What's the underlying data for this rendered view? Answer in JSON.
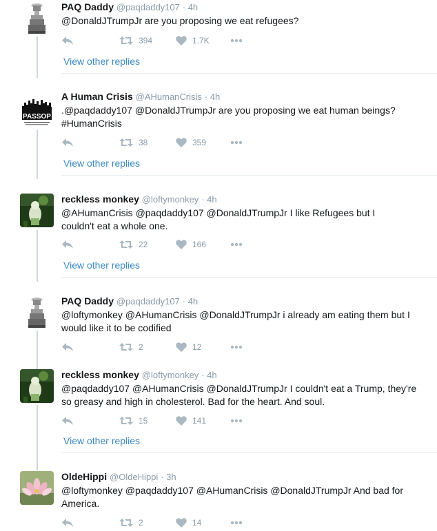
{
  "tweets": [
    {
      "name": "PAQ Daddy",
      "handle": "@paqdaddy107",
      "time": "· 4h",
      "text": "@DonaldJTrumpJr are you proposing we eat refugees?",
      "retweets": "394",
      "likes": "1.7K",
      "view_other": "View other replies",
      "avatar": "stanley-cup"
    },
    {
      "name": "A Human Crisis",
      "handle": "@AHumanCrisis",
      "time": "· 4h",
      "text": ".@paqdaddy107 @DonaldJTrumpJr are you proposing we eat human beings? #HumanCrisis",
      "retweets": "38",
      "likes": "359",
      "view_other": "View other replies",
      "avatar": "passop-logo",
      "logo_text": "PASSOP"
    },
    {
      "name": "reckless monkey",
      "handle": "@loftymonkey",
      "time": "· 4h",
      "text": "@AHumanCrisis @paqdaddy107 @DonaldJTrumpJr I like Refugees but I couldn't eat a whole one.",
      "retweets": "22",
      "likes": "166",
      "view_other": "View other replies",
      "avatar": "monkey-photo"
    },
    {
      "name": "PAQ Daddy",
      "handle": "@paqdaddy107",
      "time": "· 4h",
      "text": "@loftymonkey @AHumanCrisis @DonaldJTrumpJr i already am eating them but I would like it to be codified",
      "retweets": "2",
      "likes": "12",
      "avatar": "stanley-cup"
    },
    {
      "name": "reckless monkey",
      "handle": "@loftymonkey",
      "time": "· 4h",
      "text": "@paqdaddy107 @AHumanCrisis @DonaldJTrumpJr I couldn't eat a Trump, they're so greasy and high in cholesterol. Bad for the heart. And soul.",
      "retweets": "15",
      "likes": "141",
      "view_other": "View other replies",
      "avatar": "monkey-photo"
    },
    {
      "name": "OldeHippi",
      "handle": "@OldeHippi",
      "time": "· 3h",
      "text": "@loftymonkey @paqdaddy107 @AHumanCrisis @DonaldJTrumpJr And bad for America.",
      "retweets": "2",
      "likes": "14",
      "avatar": "lotus-flower"
    }
  ],
  "icons": {
    "reply": "reply-icon",
    "retweet": "retweet-icon",
    "like": "heart-icon",
    "more": "more-icon"
  },
  "colors": {
    "link": "#3b88c3",
    "muted": "#8899a6",
    "icon": "#aab8c2",
    "thread_line": "#ccd6dd"
  }
}
